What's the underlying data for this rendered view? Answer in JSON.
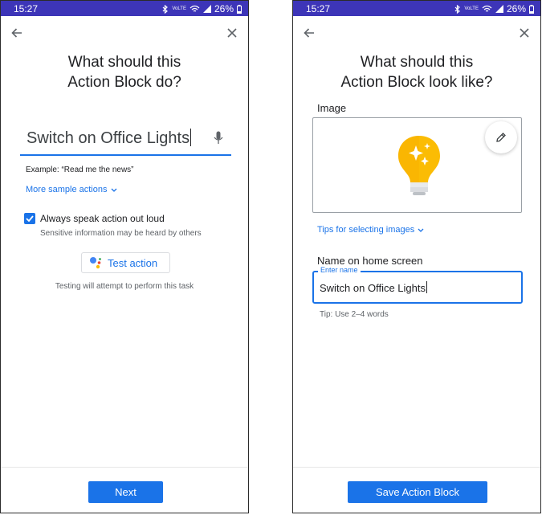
{
  "left": {
    "status": {
      "time": "15:27",
      "network": "VoLTE",
      "battery": "26%"
    },
    "title_line1": "What should this",
    "title_line2": "Action Block do?",
    "query": "Switch on Office Lights",
    "example": "Example: “Read me the news”",
    "more_samples": "More sample actions",
    "checkbox_checked": true,
    "checkbox_label": "Always speak action out loud",
    "checkbox_sub": "Sensitive information may be heard by others",
    "test_button": "Test action",
    "testing_note": "Testing will attempt to perform this task",
    "next_button": "Next"
  },
  "right": {
    "status": {
      "time": "15:27",
      "network": "VoLTE",
      "battery": "26%"
    },
    "title_line1": "What should this",
    "title_line2": "Action Block look like?",
    "image_label": "Image",
    "tips_link": "Tips for selecting images",
    "name_label": "Name on home screen",
    "name_field_label": "Enter name",
    "name_value": "Switch on Office Lights",
    "tip": "Tip: Use 2–4 words",
    "save_button": "Save Action Block"
  },
  "colors": {
    "status_bar": "#3d35b8",
    "accent": "#1a73e8",
    "bulb": "#fbbc04"
  },
  "icons": [
    "back-arrow-icon",
    "close-icon",
    "mic-icon",
    "chevron-down-icon",
    "assistant-icon",
    "pencil-icon",
    "lightbulb-icon",
    "bluetooth-icon",
    "wifi-icon",
    "signal-icon",
    "battery-icon"
  ]
}
